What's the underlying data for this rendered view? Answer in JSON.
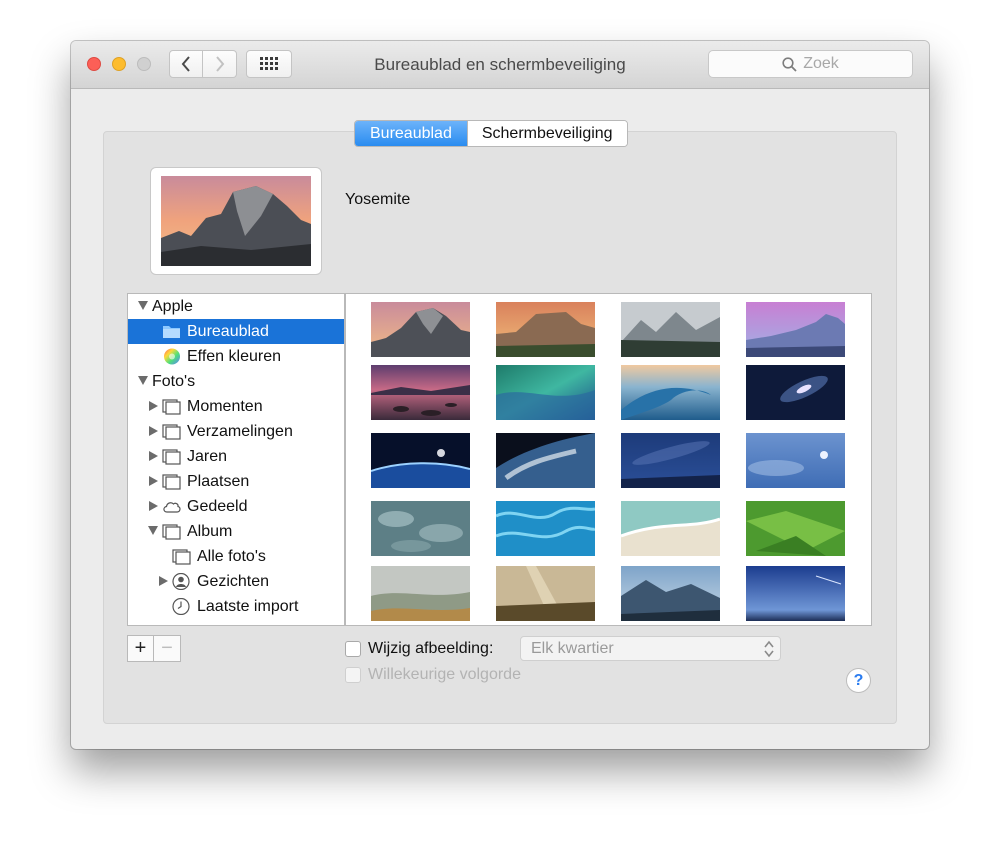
{
  "window": {
    "title": "Bureaublad en schermbeveiliging"
  },
  "search": {
    "placeholder": "Zoek"
  },
  "tabs": [
    {
      "label": "Bureaublad",
      "active": true
    },
    {
      "label": "Schermbeveiliging",
      "active": false
    }
  ],
  "current_wallpaper": {
    "name": "Yosemite"
  },
  "sidebar": {
    "apple_group": "Apple",
    "apple_items": [
      "Bureaublad",
      "Effen kleuren"
    ],
    "photos_group": "Foto's",
    "photos_items": [
      "Momenten",
      "Verzamelingen",
      "Jaren",
      "Plaatsen",
      "Gedeeld",
      "Album"
    ],
    "album_items": [
      "Alle foto's",
      "Gezichten",
      "Laatste import"
    ]
  },
  "controls": {
    "add": "+",
    "remove": "−",
    "change_picture_label": "Wijzig afbeelding:",
    "interval_value": "Elk kwartier",
    "random_order_label": "Willekeurige volgorde",
    "help": "?"
  },
  "colors": {
    "selection": "#1a73d8",
    "accent": "#2a8cf0"
  },
  "wallpapers": [
    {
      "name": "yosemite-half-dome"
    },
    {
      "name": "el-capitan"
    },
    {
      "name": "foggy-valley"
    },
    {
      "name": "half-dome-purple"
    },
    {
      "name": "lake-sunset"
    },
    {
      "name": "green-wave"
    },
    {
      "name": "ocean-wave"
    },
    {
      "name": "galaxy"
    },
    {
      "name": "earth-horizon"
    },
    {
      "name": "earth-from-space"
    },
    {
      "name": "milky-way"
    },
    {
      "name": "moon-sky"
    },
    {
      "name": "clouds"
    },
    {
      "name": "blue-water"
    },
    {
      "name": "beach"
    },
    {
      "name": "green-fields"
    },
    {
      "name": "misty-forest"
    },
    {
      "name": "sunbeam-forest"
    },
    {
      "name": "mountain-haze"
    },
    {
      "name": "blue-horizon"
    }
  ]
}
